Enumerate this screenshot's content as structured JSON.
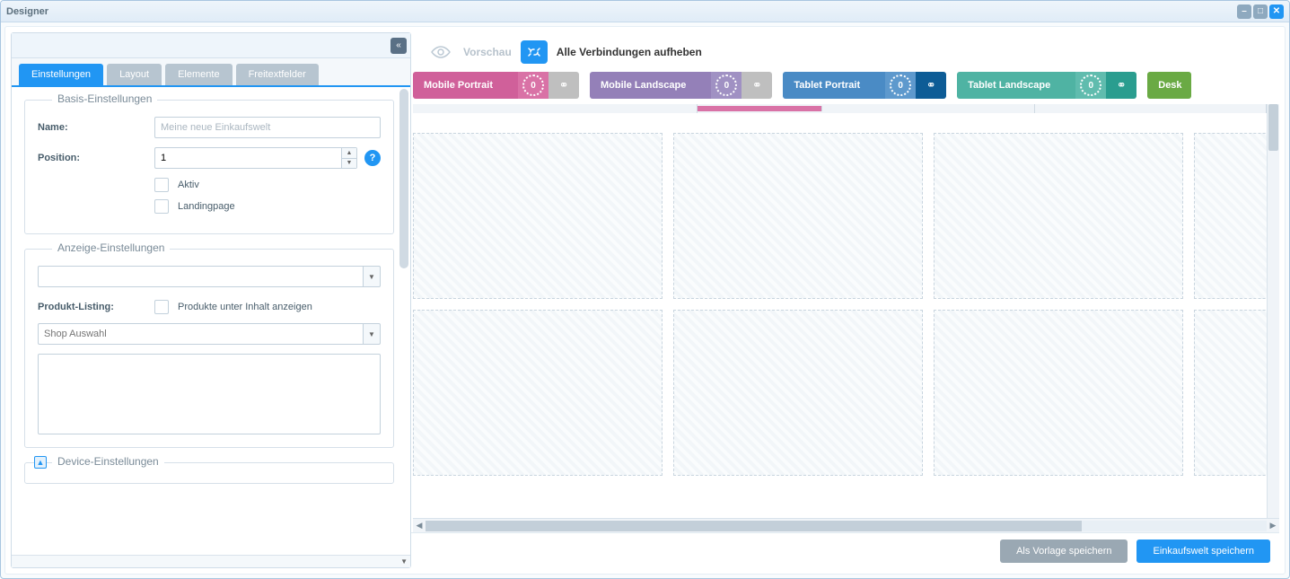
{
  "window": {
    "title": "Designer"
  },
  "sidebar": {
    "tabs": [
      "Einstellungen",
      "Layout",
      "Elemente",
      "Freitextfelder"
    ],
    "sections": {
      "basis": {
        "legend": "Basis-Einstellungen",
        "name_label": "Name:",
        "name_placeholder": "Meine neue Einkaufswelt",
        "position_label": "Position:",
        "position_value": "1",
        "aktiv_label": "Aktiv",
        "landing_label": "Landingpage"
      },
      "anzeige": {
        "legend": "Anzeige-Einstellungen",
        "listing_label": "Produkt-Listing:",
        "listing_check_label": "Produkte unter Inhalt anzeigen",
        "shop_placeholder": "Shop Auswahl"
      },
      "device": {
        "legend": "Device-Einstellungen"
      }
    }
  },
  "toolbar": {
    "preview_label": "Vorschau",
    "unlink_label": "Alle Verbindungen aufheben"
  },
  "devices": [
    {
      "label": "Mobile Portrait",
      "count": "0"
    },
    {
      "label": "Mobile Landscape",
      "count": "0"
    },
    {
      "label": "Tablet Portrait",
      "count": "0"
    },
    {
      "label": "Tablet Landscape",
      "count": "0"
    },
    {
      "label": "Desk"
    }
  ],
  "footer": {
    "template_btn": "Als Vorlage speichern",
    "save_btn": "Einkaufswelt speichern"
  }
}
